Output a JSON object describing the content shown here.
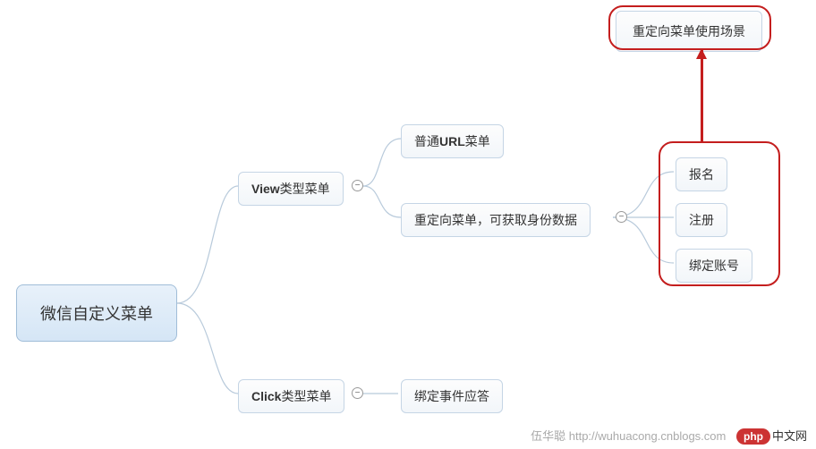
{
  "chart_data": {
    "type": "tree",
    "root": {
      "label": "微信自定义菜单",
      "children": [
        {
          "label": "View类型菜单",
          "children": [
            {
              "label": "普通URL菜单"
            },
            {
              "label": "重定向菜单，可获取身份数据",
              "children": [
                {
                  "label": "报名"
                },
                {
                  "label": "注册"
                },
                {
                  "label": "绑定账号"
                }
              ],
              "annotation": "重定向菜单使用场景"
            }
          ]
        },
        {
          "label": "Click类型菜单",
          "children": [
            {
              "label": "绑定事件应答"
            }
          ]
        }
      ]
    }
  },
  "nodes": {
    "root": "微信自定义菜单",
    "view": "View类型菜单",
    "click": "Click类型菜单",
    "url": "普通URL菜单",
    "redirect": "重定向菜单，可获取身份数据",
    "signup": "报名",
    "register": "注册",
    "bind": "绑定账号",
    "events": "绑定事件应答",
    "callout": "重定向菜单使用场景"
  },
  "collapse_symbol": "−",
  "watermark": {
    "author": "伍华聪 http://wuhuacong.cnblogs.com",
    "php": "php",
    "site": "中文网"
  }
}
